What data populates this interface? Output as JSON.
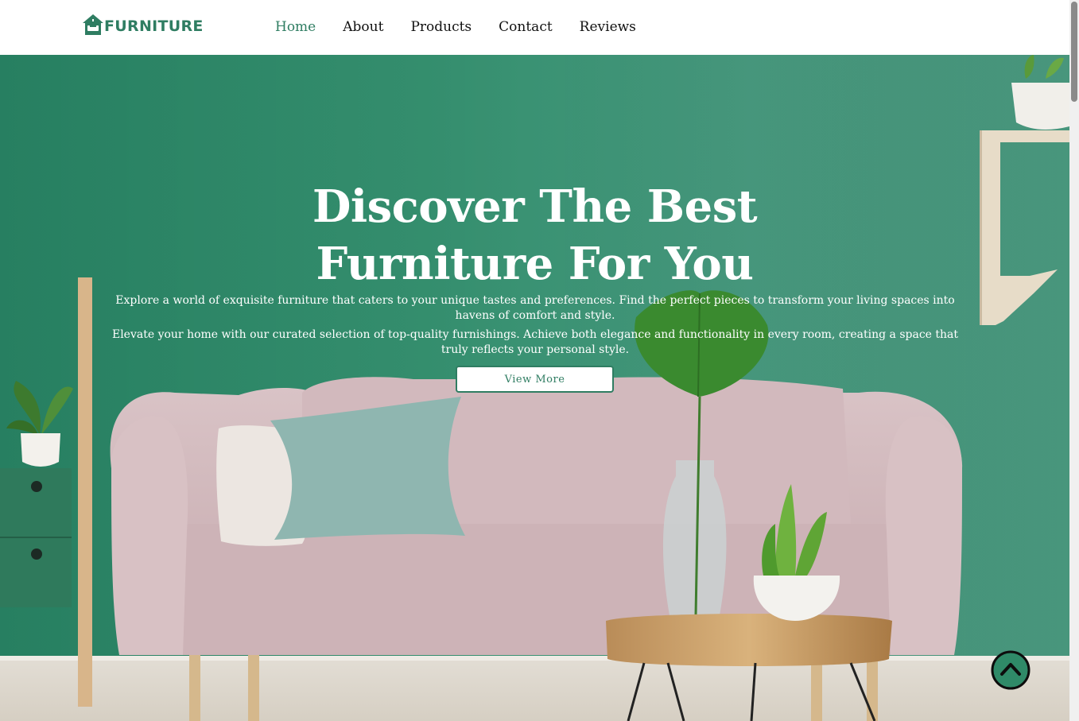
{
  "brand": {
    "name": "FURNITURE",
    "logo_icon": "house-sofa-icon",
    "color": "#2f7d62"
  },
  "nav": {
    "items": [
      {
        "label": "Home",
        "active": true
      },
      {
        "label": "About",
        "active": false
      },
      {
        "label": "Products",
        "active": false
      },
      {
        "label": "Contact",
        "active": false
      },
      {
        "label": "Reviews",
        "active": false
      }
    ]
  },
  "hero": {
    "title_line1": "Discover The Best",
    "title_line2": "Furniture For You",
    "desc1": "Explore a world of exquisite furniture that caters to your unique tastes and preferences. Find the perfect pieces to transform your living spaces into havens of comfort and style.",
    "desc2": "Elevate your home with our curated selection of top-quality furnishings. Achieve both elegance and functionality in every room, creating a space that truly reflects your personal style.",
    "button_label": "View More",
    "background_color": "#35906f"
  },
  "back_to_top": {
    "icon": "chevron-up-circle-icon"
  }
}
